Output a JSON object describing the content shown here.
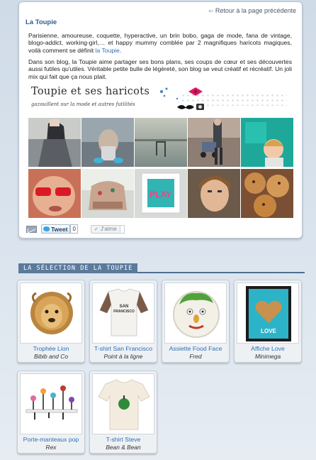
{
  "card": {
    "back_link": "Retour à la page précédente",
    "title": "La Toupie",
    "p1_a": "Parisienne, amoureuse, coquette, hyperactive, un brin bobo, gaga de mode, fana de vintage, blogo-addict, working-girl,… et happy mummy comblée par 2 magnifiques haricots magiques, voilà comment se définit ",
    "p1_link": "la Toupie",
    "p1_b": ".",
    "p2": "Dans son blog, la Toupie aime partager ses bons plans,  ses coups de cœur et ses découvertes aussi futiles qu'utiles. Véritable petite bulle de légèreté,  son blog se veut créatif et récréatif. Un joli mix qui fait que ça nous plait.",
    "banner_title": "Toupie et ses haricots",
    "banner_subtitle": "gazouillent sur la mode et autres futilités",
    "share": {
      "tweet_label": "Tweet",
      "tweet_count": "0",
      "like_label": "J'aime"
    }
  },
  "photos": [
    {
      "name": "photo-girl-skirt"
    },
    {
      "name": "photo-child-blue-shoes"
    },
    {
      "name": "photo-lake-pier"
    },
    {
      "name": "photo-woman-stroller"
    },
    {
      "name": "photo-child-teal"
    },
    {
      "name": "photo-red-sunglasses"
    },
    {
      "name": "photo-armchair"
    },
    {
      "name": "photo-play-sign"
    },
    {
      "name": "photo-woman-portrait"
    },
    {
      "name": "photo-cookies"
    }
  ],
  "section": {
    "title": "LA SÉLECTION DE LA TOUPIE"
  },
  "products": [
    {
      "name": "Trophée Lion",
      "brand": "Bibib and Co"
    },
    {
      "name": "T-shirt San Francisco",
      "brand": "Point à la ligne"
    },
    {
      "name": "Assiette Food Face",
      "brand": "Fred"
    },
    {
      "name": "Affiche Love",
      "brand": "Minimega"
    },
    {
      "name": "Porte-manteaux pop",
      "brand": "Rex"
    },
    {
      "name": "T-shirt Steve",
      "brand": "Bean & Bean"
    }
  ],
  "product_art": {
    "tshirt_sf_text": "SAN\nFRANCISCO",
    "poster_text": "LOVE"
  }
}
